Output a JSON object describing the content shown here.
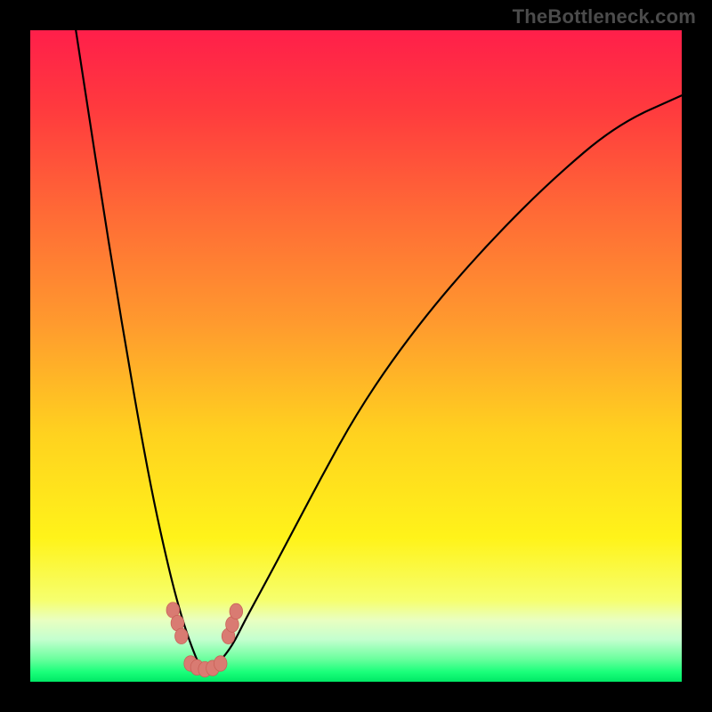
{
  "watermark": "TheBottleneck.com",
  "colors": {
    "frame": "#000000",
    "curve": "#000000",
    "marker_fill": "#d97b72",
    "marker_stroke": "#c85f56",
    "gradient_stops": [
      {
        "offset": 0.0,
        "color": "#ff1f4a"
      },
      {
        "offset": 0.12,
        "color": "#ff3a3e"
      },
      {
        "offset": 0.28,
        "color": "#ff6a36"
      },
      {
        "offset": 0.45,
        "color": "#ff9a2e"
      },
      {
        "offset": 0.62,
        "color": "#ffd21f"
      },
      {
        "offset": 0.78,
        "color": "#fff31a"
      },
      {
        "offset": 0.875,
        "color": "#f6ff6e"
      },
      {
        "offset": 0.905,
        "color": "#e9ffc0"
      },
      {
        "offset": 0.935,
        "color": "#c4ffcf"
      },
      {
        "offset": 0.965,
        "color": "#6bff9e"
      },
      {
        "offset": 0.985,
        "color": "#1aff7a"
      },
      {
        "offset": 1.0,
        "color": "#00e865"
      }
    ]
  },
  "chart_data": {
    "type": "line",
    "title": "",
    "xlabel": "",
    "ylabel": "",
    "xlim": [
      0,
      1000
    ],
    "ylim": [
      0,
      1000
    ],
    "note": "Axes are in abstract 0–1000 units mapped to the plot area; y=0 is the bottom (green), y=1000 is the top (red). The curve is a V-shaped bottleneck profile with a minimum near the lower-left.",
    "series": [
      {
        "name": "curve",
        "x": [
          70,
          90,
          110,
          130,
          150,
          170,
          190,
          210,
          225,
          240,
          255,
          265,
          275,
          290,
          310,
          330,
          360,
          400,
          450,
          500,
          560,
          630,
          710,
          800,
          900,
          1000
        ],
        "y": [
          1000,
          870,
          740,
          615,
          495,
          380,
          275,
          185,
          125,
          75,
          35,
          15,
          15,
          30,
          55,
          95,
          150,
          225,
          320,
          410,
          500,
          590,
          680,
          770,
          855,
          900
        ]
      }
    ],
    "markers": [
      {
        "x": 219,
        "y": 110
      },
      {
        "x": 226,
        "y": 90
      },
      {
        "x": 232,
        "y": 70
      },
      {
        "x": 304,
        "y": 70
      },
      {
        "x": 310,
        "y": 88
      },
      {
        "x": 316,
        "y": 108
      },
      {
        "x": 246,
        "y": 28
      },
      {
        "x": 256,
        "y": 22
      },
      {
        "x": 268,
        "y": 19
      },
      {
        "x": 280,
        "y": 21
      },
      {
        "x": 292,
        "y": 28
      }
    ]
  }
}
